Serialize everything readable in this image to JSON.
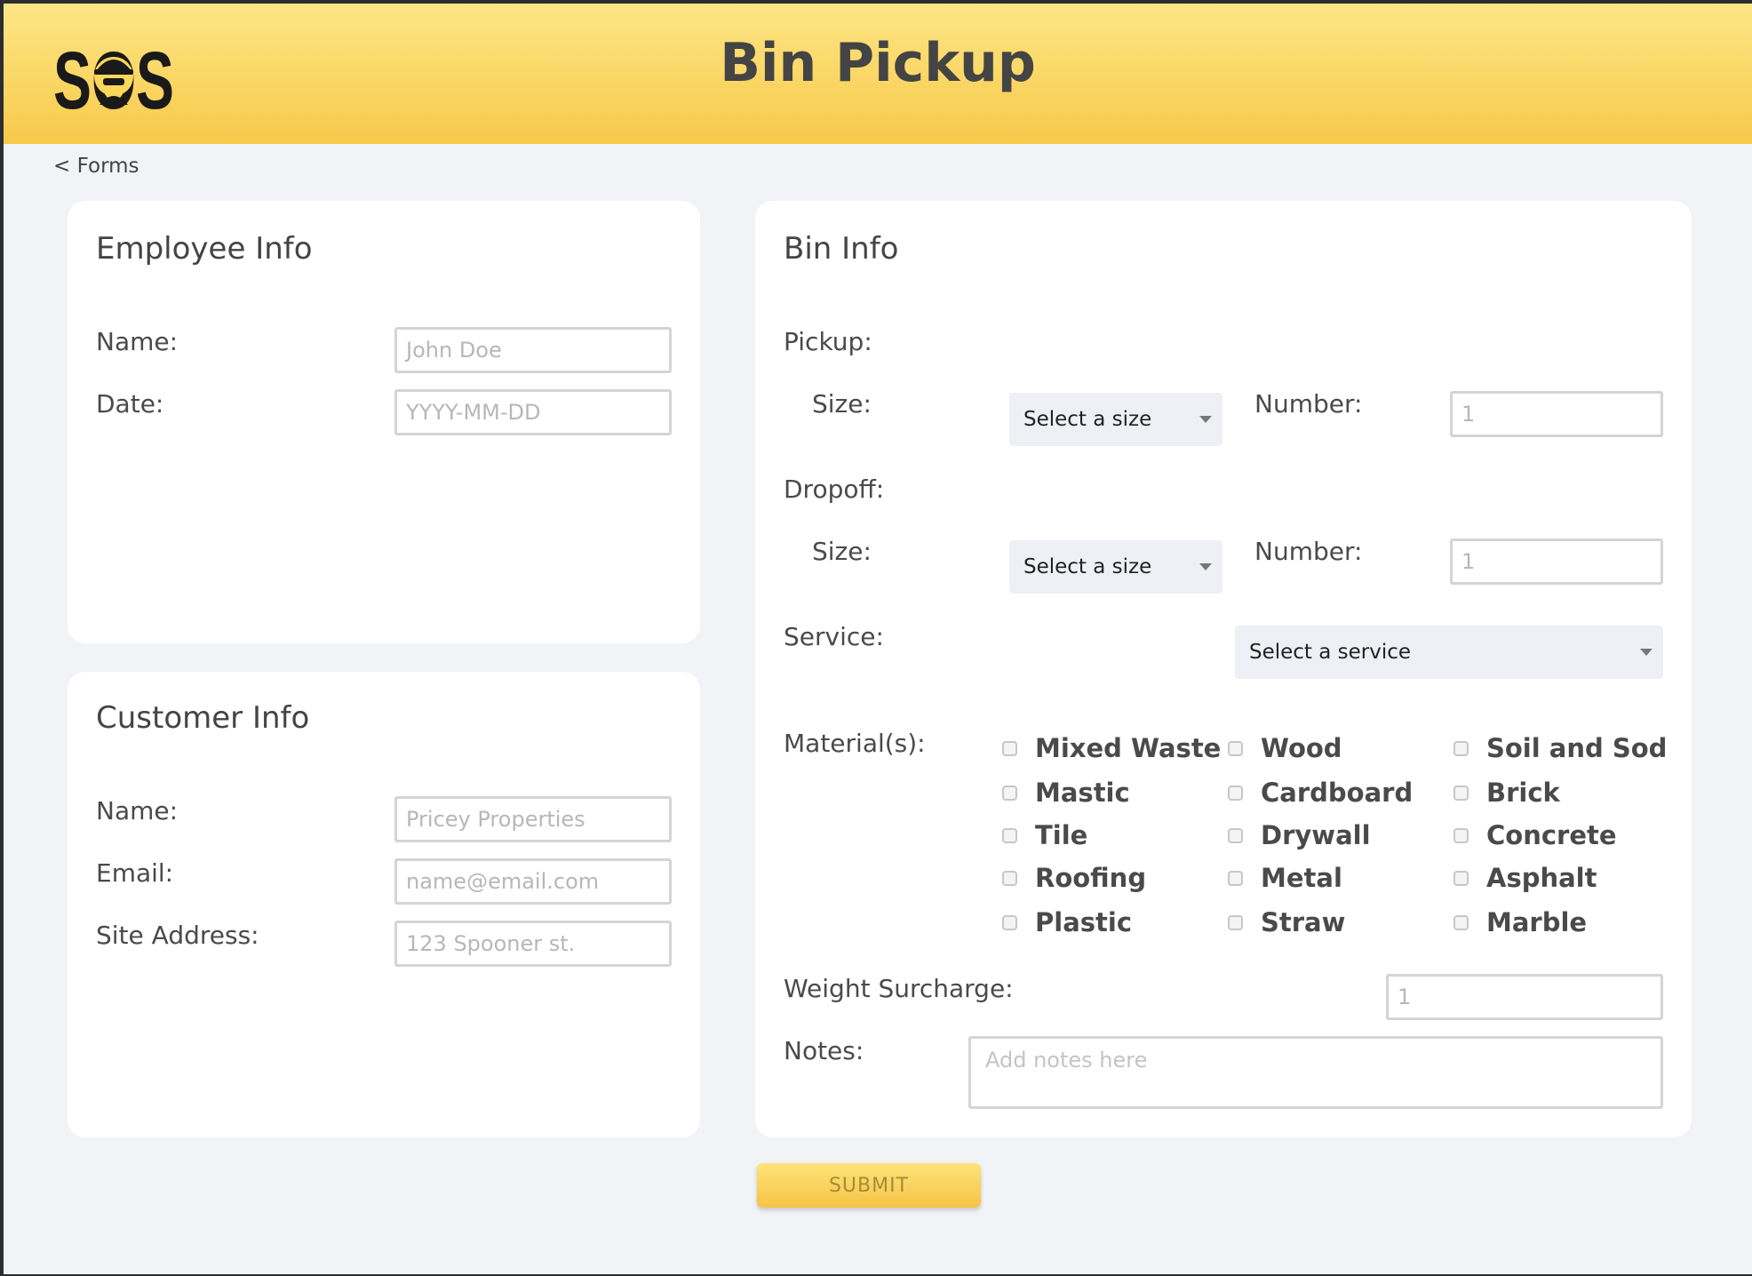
{
  "header": {
    "logo_text": "SOS",
    "title": "Bin Pickup"
  },
  "nav": {
    "back_link": "< Forms"
  },
  "employee_info": {
    "title": "Employee Info",
    "name_label": "Name:",
    "name_placeholder": "John Doe",
    "date_label": "Date:",
    "date_placeholder": "YYYY-MM-DD"
  },
  "customer_info": {
    "title": "Customer Info",
    "name_label": "Name:",
    "name_placeholder": "Pricey Properties",
    "email_label": "Email:",
    "email_placeholder": "name@email.com",
    "address_label": "Site Address:",
    "address_placeholder": "123 Spooner st."
  },
  "bin_info": {
    "title": "Bin Info",
    "pickup": {
      "label": "Pickup:",
      "size_label": "Size:",
      "size_value": "Select a size",
      "number_label": "Number:",
      "number_placeholder": "1"
    },
    "dropoff": {
      "label": "Dropoff:",
      "size_label": "Size:",
      "size_value": "Select a size",
      "number_label": "Number:",
      "number_placeholder": "1"
    },
    "service": {
      "label": "Service:",
      "value": "Select a service"
    },
    "materials": {
      "label": "Material(s):",
      "items": [
        "Mixed Waste",
        "Wood",
        "Soil and Sod",
        "Mastic",
        "Cardboard",
        "Brick",
        "Tile",
        "Drywall",
        "Concrete",
        "Roofing",
        "Metal",
        "Asphalt",
        "Plastic",
        "Straw",
        "Marble"
      ]
    },
    "weight_surcharge": {
      "label": "Weight Surcharge:",
      "placeholder": "1"
    },
    "notes": {
      "label": "Notes:",
      "placeholder": "Add notes here"
    }
  },
  "submit": {
    "label": "SUBMIT"
  },
  "colors": {
    "header_top": "#fde686",
    "header_bottom": "#f8c94a",
    "background": "#f2f3f7",
    "card": "#ffffff"
  }
}
